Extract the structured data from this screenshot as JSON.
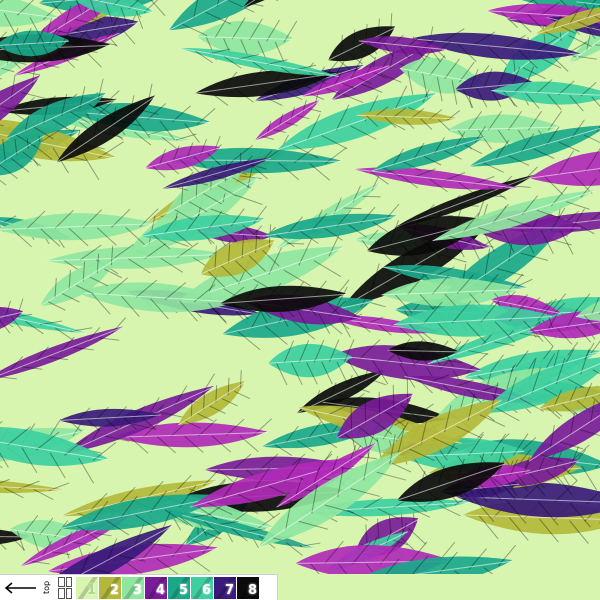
{
  "legend": {
    "top_label": "top",
    "swatches": [
      {
        "number": "1",
        "color": "#d8f5b0",
        "text_color": "#ffffff"
      },
      {
        "number": "2",
        "color": "#b3b83a",
        "text_color": "#ffffff"
      },
      {
        "number": "3",
        "color": "#8fe6a0",
        "text_color": "#ffffff"
      },
      {
        "number": "4",
        "color": "#7a1b9a",
        "text_color": "#ffffff"
      },
      {
        "number": "5",
        "color": "#1aa88a",
        "text_color": "#ffffff"
      },
      {
        "number": "6",
        "color": "#3dcfa0",
        "text_color": "#ffffff"
      },
      {
        "number": "7",
        "color": "#3a1a7a",
        "text_color": "#ffffff"
      },
      {
        "number": "8",
        "color": "#0b0b0b",
        "text_color": "#ffffff"
      }
    ]
  },
  "palette": {
    "background": "#d8f5b0",
    "olive": "#b3b83a",
    "mint": "#8fe6a0",
    "purple": "#7a1b9a",
    "teal": "#1aa88a",
    "aqua": "#3dcfa0",
    "indigo": "#3a1a7a",
    "black": "#0b0b0b",
    "magenta": "#b02ab8"
  }
}
